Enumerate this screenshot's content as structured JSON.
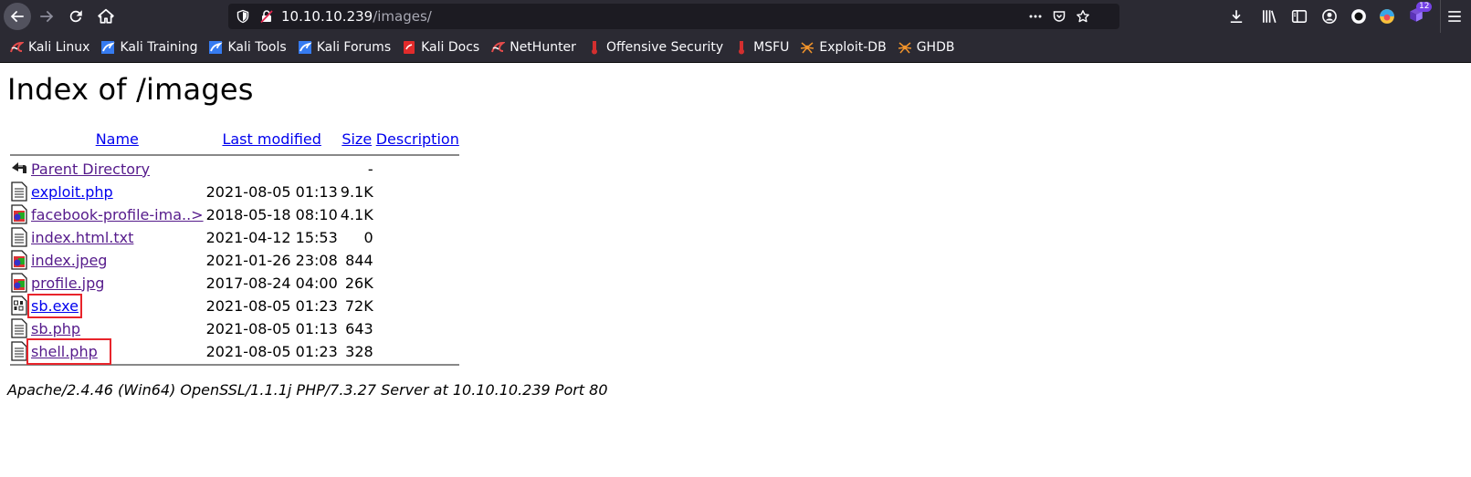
{
  "browser": {
    "url_host": "10.10.10.239",
    "url_path": "/images/",
    "extension_badge": "12"
  },
  "bookmarks": [
    {
      "label": "Kali Linux",
      "icon": "kali-dragon-icon"
    },
    {
      "label": "Kali Training",
      "icon": "kali-training-icon"
    },
    {
      "label": "Kali Tools",
      "icon": "kali-tools-icon"
    },
    {
      "label": "Kali Forums",
      "icon": "kali-forums-icon"
    },
    {
      "label": "Kali Docs",
      "icon": "kali-docs-icon"
    },
    {
      "label": "NetHunter",
      "icon": "nethunter-icon"
    },
    {
      "label": "Offensive Security",
      "icon": "offsec-icon"
    },
    {
      "label": "MSFU",
      "icon": "msfu-icon"
    },
    {
      "label": "Exploit-DB",
      "icon": "exploitdb-icon"
    },
    {
      "label": "GHDB",
      "icon": "ghdb-icon"
    }
  ],
  "page": {
    "title": "Index of /images",
    "headers": {
      "name": "Name",
      "last_modified": "Last modified",
      "size": "Size",
      "description": "Description"
    },
    "parent": {
      "name": "Parent Directory",
      "size": "-"
    },
    "rows": [
      {
        "name": "exploit.php",
        "modified": "2021-08-05 01:13",
        "size": "9.1K",
        "icon": "text-file-icon"
      },
      {
        "name": "facebook-profile-ima..>",
        "modified": "2018-05-18 08:10",
        "size": "4.1K",
        "icon": "image-file-icon"
      },
      {
        "name": "index.html.txt",
        "modified": "2021-04-12 15:53",
        "size": "0",
        "icon": "text-file-icon"
      },
      {
        "name": "index.jpeg",
        "modified": "2021-01-26 23:08",
        "size": "844",
        "icon": "image-file-icon"
      },
      {
        "name": "profile.jpg",
        "modified": "2017-08-24 04:00",
        "size": "26K",
        "icon": "image-file-icon"
      },
      {
        "name": "sb.exe",
        "modified": "2021-08-05 01:23",
        "size": "72K",
        "icon": "binary-file-icon"
      },
      {
        "name": "sb.php",
        "modified": "2021-08-05 01:13",
        "size": "643",
        "icon": "text-file-icon"
      },
      {
        "name": "shell.php",
        "modified": "2021-08-05 01:23",
        "size": "328",
        "icon": "text-file-icon"
      }
    ],
    "footer": "Apache/2.4.46 (Win64) OpenSSL/1.1.1j PHP/7.3.27 Server at 10.10.10.239 Port 80"
  },
  "colors": {
    "chrome": "#2b2a33",
    "urlbar": "#1c1b22",
    "link": "#0000ee",
    "visited": "#551a8b",
    "highlight_box": "#e8242b"
  }
}
